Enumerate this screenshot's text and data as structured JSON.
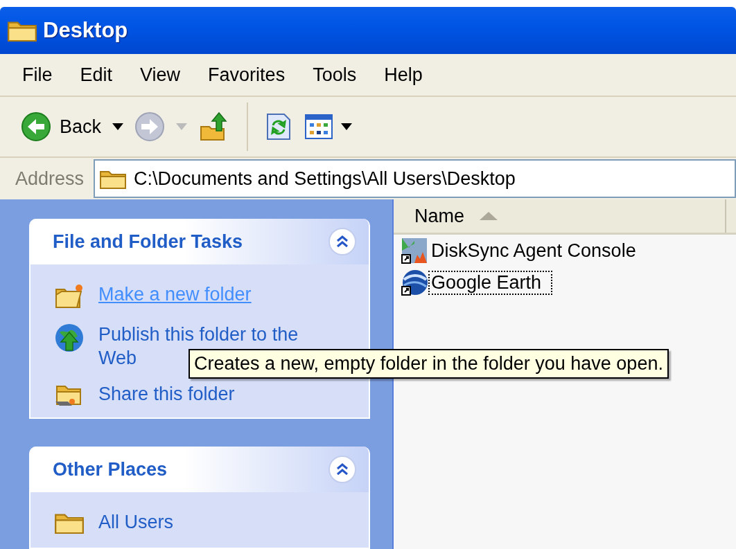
{
  "window": {
    "title": "Desktop"
  },
  "menu": [
    "File",
    "Edit",
    "View",
    "Favorites",
    "Tools",
    "Help"
  ],
  "toolbar": {
    "back_label": "Back",
    "forward_disabled": true
  },
  "address": {
    "label": "Address",
    "value": "C:\\Documents and Settings\\All Users\\Desktop"
  },
  "panels": [
    {
      "title": "File and Folder Tasks",
      "expanded": true,
      "items": [
        {
          "label": "Make a new folder",
          "kind": "new-folder",
          "hovered": true
        },
        {
          "label": "Publish this folder to the Web",
          "kind": "publish",
          "hovered": false
        },
        {
          "label": "Share this folder",
          "kind": "share",
          "hovered": false
        }
      ]
    },
    {
      "title": "Other Places",
      "expanded": true,
      "items": [
        {
          "label": "All Users",
          "kind": "folder",
          "hovered": false
        }
      ]
    }
  ],
  "file_list": {
    "columns": [
      {
        "label": "Name",
        "sort_ascending": true
      }
    ],
    "items": [
      {
        "name": "DiskSync Agent Console",
        "kind": "app",
        "focused": false
      },
      {
        "name": "Google Earth",
        "kind": "globe",
        "focused": true
      }
    ]
  },
  "tooltip": {
    "text": "Creates a new, empty folder in the folder you have open."
  }
}
